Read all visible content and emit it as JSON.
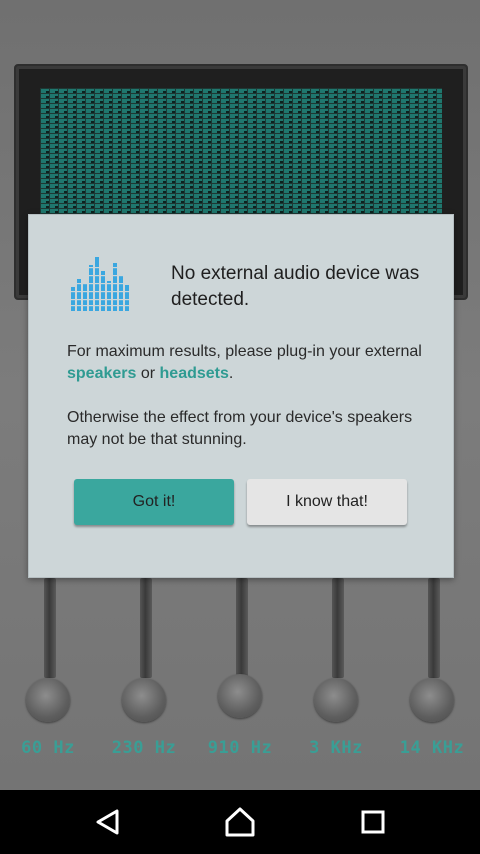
{
  "equalizer": {
    "bands": [
      {
        "label": "60 Hz"
      },
      {
        "label": "230 Hz"
      },
      {
        "label": "910 Hz"
      },
      {
        "label": "3 KHz"
      },
      {
        "label": "14 KHz"
      }
    ]
  },
  "dialog": {
    "icon": "equalizer-bars-icon",
    "title": "No external audio device was detected.",
    "message1": {
      "before": "For maximum results, please plug-in your external ",
      "link1": "speakers",
      "middle": " or ",
      "link2": "headsets",
      "after": "."
    },
    "message2": "Otherwise the effect from your device's speakers may not be that stunning.",
    "primary_button": "Got it!",
    "secondary_button": "I know that!"
  },
  "navbar": {
    "back_icon": "back-triangle-icon",
    "home_icon": "home-icon",
    "recents_icon": "recents-square-icon"
  },
  "colors": {
    "accent": "#3aa79e",
    "dialog_bg": "#cdd6d8",
    "band_label": "#3a9e95"
  }
}
